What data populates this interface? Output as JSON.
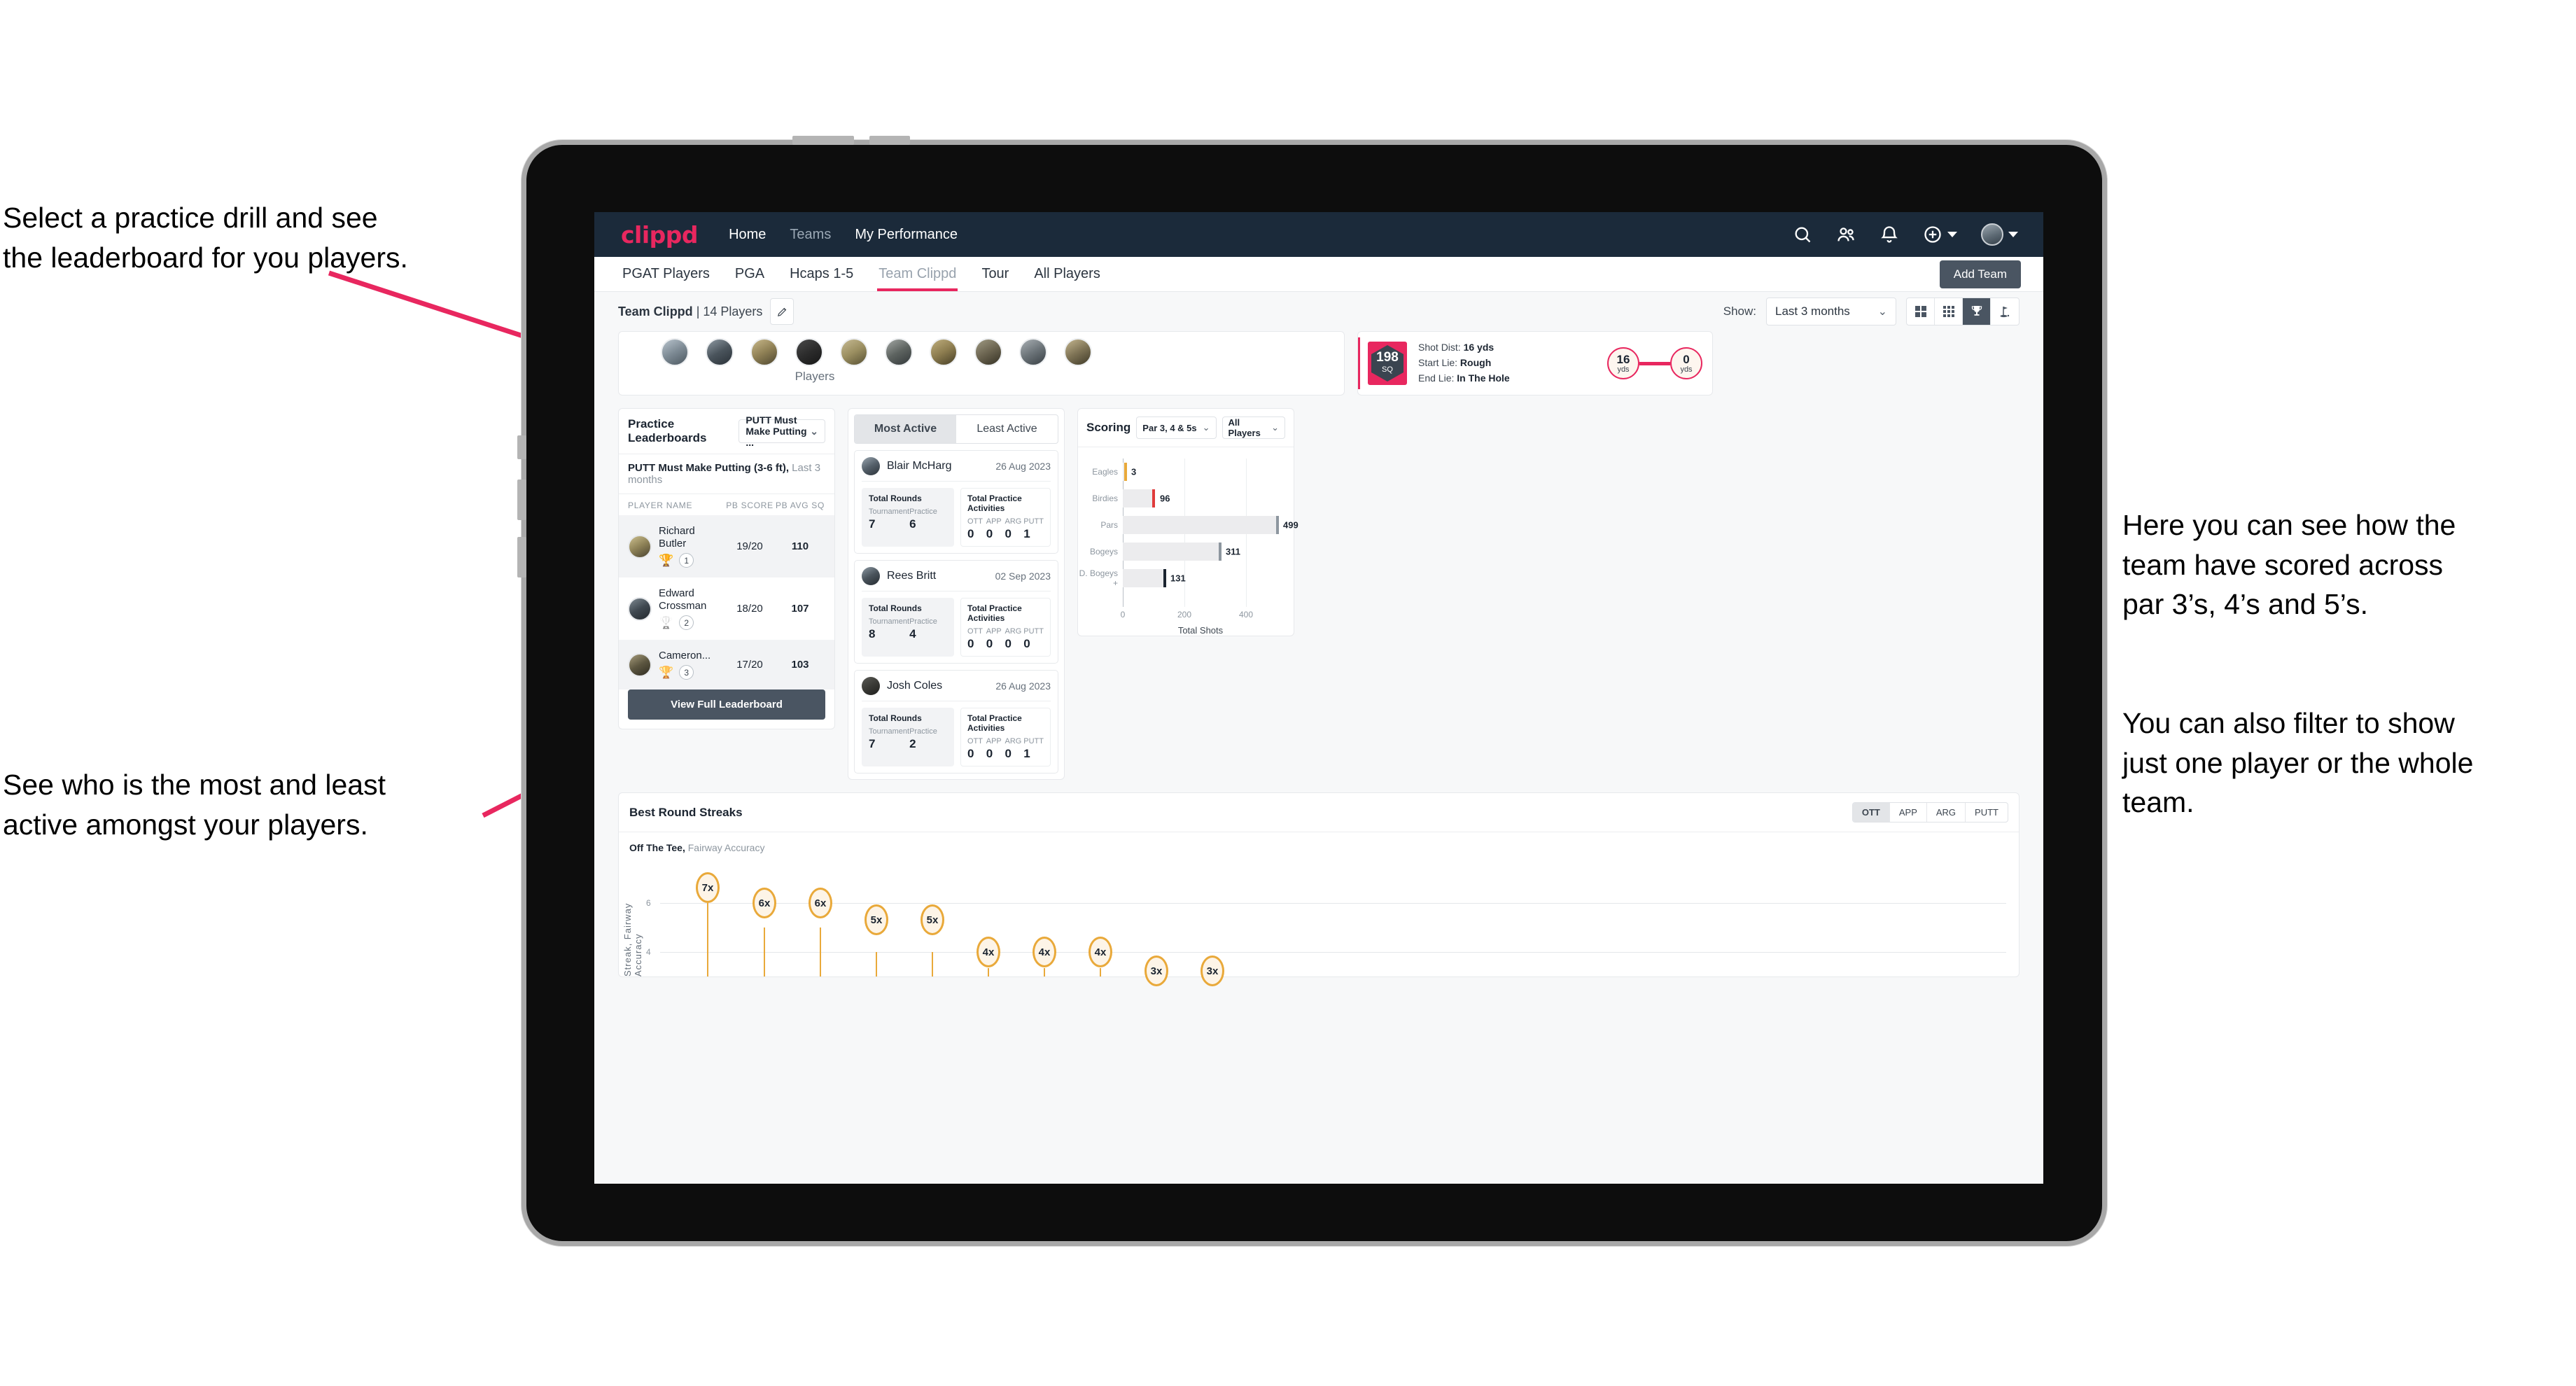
{
  "annotations": {
    "top_left": "Select a practice drill and see\nthe leaderboard for you players.",
    "bottom_left": "See who is the most and least\nactive amongst your players.",
    "right_1": "Here you can see how the\nteam have scored across\npar 3’s, 4’s and 5’s.",
    "right_2": "You can also filter to show\njust one player or the whole\nteam."
  },
  "colors": {
    "brand_pink": "#e8275f",
    "navbar": "#1b2a3a",
    "button_slate": "#4a5562",
    "streak_amber": "#e9a93a"
  },
  "navbar": {
    "brand": "clippd",
    "links": [
      {
        "label": "Home",
        "active": true
      },
      {
        "label": "Teams",
        "active": false
      },
      {
        "label": "My Performance",
        "active": true
      }
    ],
    "icons": [
      "search-icon",
      "people-icon",
      "bell-icon",
      "plus-circle-icon",
      "avatar"
    ]
  },
  "tabs": {
    "items": [
      "PGAT Players",
      "PGA",
      "Hcaps 1-5",
      "Team Clippd",
      "Tour",
      "All Players"
    ],
    "active": "Team Clippd",
    "add_team_label": "Add Team"
  },
  "toolbar": {
    "team_name": "Team Clippd",
    "separator": " | ",
    "player_count": "14 Players",
    "show_label": "Show:",
    "show_value": "Last 3 months",
    "view_modes": [
      "grid-2x2",
      "grid-3x3",
      "trophy",
      "golf-flag"
    ],
    "active_view": "trophy"
  },
  "players_strip": {
    "caption": "Players",
    "avatar_count": 10
  },
  "shot_card": {
    "sq_value": "198",
    "sq_unit": "SQ",
    "lines": [
      {
        "label": "Shot Dist:",
        "value": "16 yds"
      },
      {
        "label": "Start Lie:",
        "value": "Rough"
      },
      {
        "label": "End Lie:",
        "value": "In The Hole"
      }
    ],
    "start_yds": "16",
    "end_yds": "0",
    "yds_unit": "yds"
  },
  "leaderboard": {
    "title": "Practice Leaderboards",
    "drill_select": "PUTT Must Make Putting ...",
    "subtitle_bold": "PUTT Must Make Putting (3-6 ft),",
    "subtitle_light": "Last 3 months",
    "columns": [
      "PLAYER NAME",
      "PB SCORE",
      "PB AVG SQ"
    ],
    "rows": [
      {
        "name": "Richard Butler",
        "rank": "1",
        "trophy": "gold",
        "score": "19/20",
        "avg": "110"
      },
      {
        "name": "Edward Crossman",
        "rank": "2",
        "trophy": "silver",
        "score": "18/20",
        "avg": "107"
      },
      {
        "name": "Cameron...",
        "rank": "3",
        "trophy": "bronze",
        "score": "17/20",
        "avg": "103"
      }
    ],
    "button_label": "View Full Leaderboard"
  },
  "activity": {
    "tabs": [
      "Most Active",
      "Least Active"
    ],
    "active_tab": "Most Active",
    "rounds_title": "Total Rounds",
    "rounds_labels": [
      "Tournament",
      "Practice"
    ],
    "practice_title": "Total Practice Activities",
    "practice_labels": [
      "OTT",
      "APP",
      "ARG",
      "PUTT"
    ],
    "items": [
      {
        "name": "Blair McHarg",
        "date": "26 Aug 2023",
        "tournament": "7",
        "practice": "6",
        "ott": "0",
        "app": "0",
        "arg": "0",
        "putt": "1"
      },
      {
        "name": "Rees Britt",
        "date": "02 Sep 2023",
        "tournament": "8",
        "practice": "4",
        "ott": "0",
        "app": "0",
        "arg": "0",
        "putt": "0"
      },
      {
        "name": "Josh Coles",
        "date": "26 Aug 2023",
        "tournament": "7",
        "practice": "2",
        "ott": "0",
        "app": "0",
        "arg": "0",
        "putt": "1"
      }
    ]
  },
  "scoring": {
    "title": "Scoring",
    "par_select": "Par 3, 4 & 5s",
    "player_select": "All Players"
  },
  "streaks": {
    "title": "Best Round Streaks",
    "toggle": [
      "OTT",
      "APP",
      "ARG",
      "PUTT"
    ],
    "active_toggle": "OTT",
    "subtitle_bold": "Off The Tee,",
    "subtitle_light": "Fairway Accuracy",
    "y_axis_label": "Streak, Fairway Accuracy"
  },
  "chart_data": [
    {
      "type": "bar",
      "orientation": "horizontal",
      "title": "Scoring",
      "categories": [
        "Eagles",
        "Birdies",
        "Pars",
        "Bogeys",
        "D. Bogeys +"
      ],
      "values": [
        3,
        96,
        499,
        311,
        131
      ],
      "cap_colors": [
        "#e9a93a",
        "#e03b3b",
        "#8d969f",
        "#8d969f",
        "#1b2430"
      ],
      "xlabel": "Total Shots",
      "ylabel": "",
      "xlim": [
        0,
        520
      ],
      "xticks": [
        0,
        200,
        400
      ],
      "grid": true,
      "legend": "none"
    },
    {
      "type": "scatter",
      "title": "Best Round Streaks",
      "subtitle": "Off The Tee, Fairway Accuracy",
      "ylabel": "Streak, Fairway Accuracy",
      "xlabel": "",
      "ylim": [
        0,
        8
      ],
      "yticks": [
        4,
        6
      ],
      "grid": true,
      "marker_style": "lollipop",
      "categories": [
        "p1",
        "p2",
        "p3",
        "p4",
        "p5",
        "p6",
        "p7",
        "p8",
        "p9",
        "p10"
      ],
      "values": [
        7,
        6,
        6,
        5,
        5,
        4,
        4,
        4,
        3,
        3
      ],
      "labels": [
        "7x",
        "6x",
        "6x",
        "5x",
        "5x",
        "4x",
        "4x",
        "4x",
        "3x",
        "3x"
      ]
    }
  ]
}
